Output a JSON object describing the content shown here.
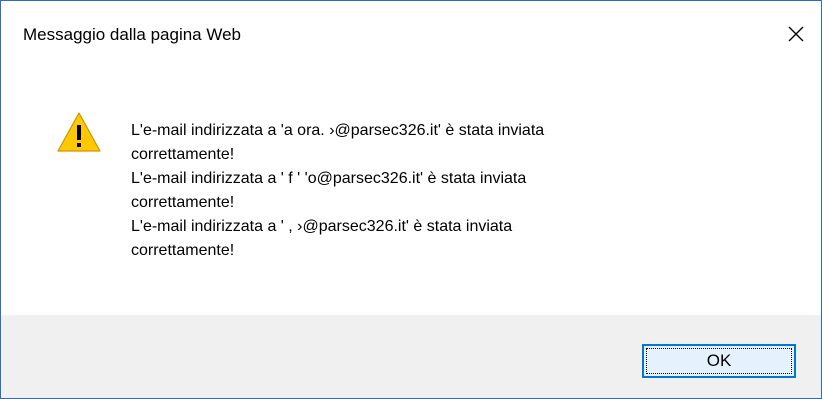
{
  "window": {
    "title": "Messaggio dalla pagina Web",
    "close_icon": "close-icon"
  },
  "message": {
    "icon": "warning-icon",
    "lines": [
      "L'e-mail indirizzata a 'a          ora.   ›@parsec326.it' è stata inviata",
      "correttamente!",
      "L'e-mail indirizzata a '        f       '   'o@parsec326.it' è stata inviata",
      "correttamente!",
      "L'e-mail indirizzata a '                 ,  ›@parsec326.it' è stata inviata",
      "correttamente!"
    ]
  },
  "buttons": {
    "ok_label": "OK"
  },
  "colors": {
    "window_border": "#2b6fb6",
    "footer_bg": "#f0f0f0",
    "button_focus_border": "#0078d7",
    "button_bg": "#e5f1fb",
    "warning_fill": "#ffc800"
  }
}
